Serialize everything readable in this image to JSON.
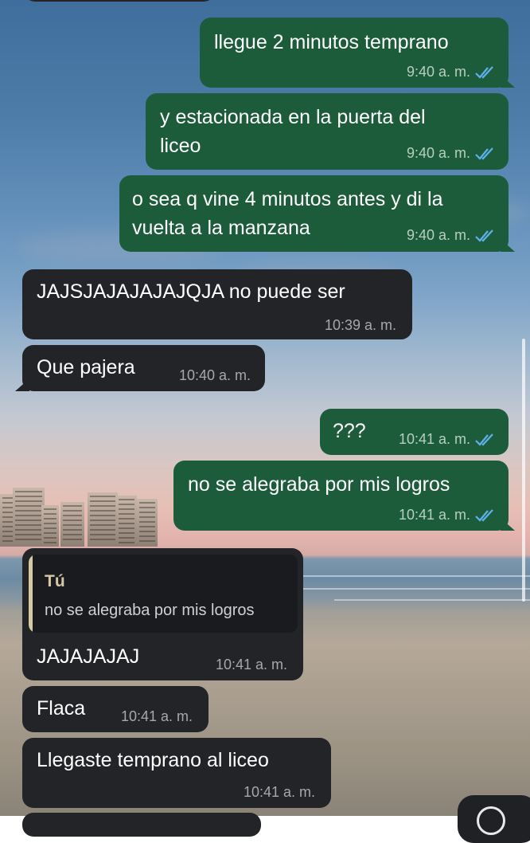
{
  "messages": [
    {
      "text": "llegue 2 minutos temprano",
      "time": "9:40 a. m.",
      "ticks": "double-check-read"
    },
    {
      "line1": "y estacionada en la puerta del",
      "line2": "liceo",
      "time": "9:40 a. m.",
      "ticks": "double-check-read"
    },
    {
      "line1": "o sea q vine 4 minutos antes y di la",
      "line2": "vuelta a la manzana",
      "time": "9:40 a. m.",
      "ticks": "double-check-read"
    },
    {
      "text": "JAJSJAJAJAJAJQJA no puede ser",
      "time": "10:39 a. m."
    },
    {
      "text": "Que pajera",
      "time": "10:40 a. m."
    },
    {
      "text": "???",
      "time": "10:41 a. m.",
      "ticks": "double-check-read"
    },
    {
      "text": "no se alegraba por mis logros",
      "time": "10:41 a. m.",
      "ticks": "double-check-read"
    },
    {
      "quote_author": "Tú",
      "quote_text": "no se alegraba por mis logros",
      "text": "JAJAJAJAJ",
      "time": "10:41 a. m."
    },
    {
      "text": "Flaca",
      "time": "10:41 a. m."
    },
    {
      "text": "Llegaste temprano al liceo",
      "time": "10:41 a. m."
    }
  ],
  "colors": {
    "outgoing_bubble": "#1c5c3b",
    "incoming_bubble": "#232427",
    "read_ticks": "#5fb0f0",
    "quote_accent": "#d8c9a6"
  }
}
